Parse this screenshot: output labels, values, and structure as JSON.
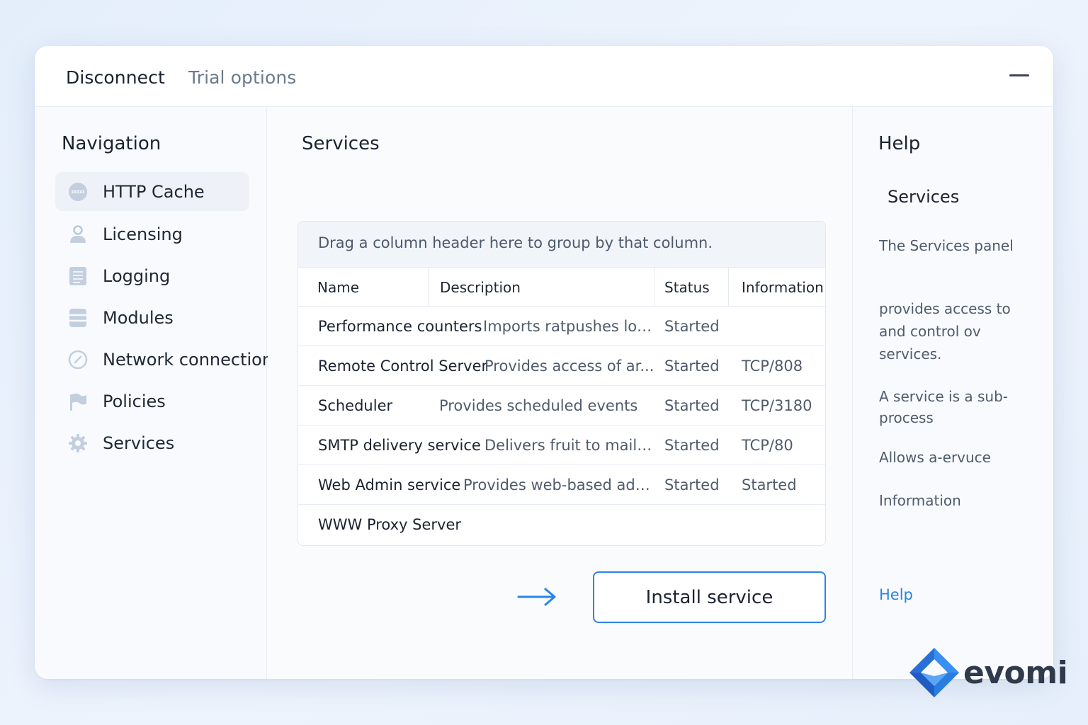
{
  "topbar": {
    "tabs": [
      {
        "label": "Disconnect",
        "active": true
      },
      {
        "label": "Trial options",
        "active": false
      }
    ]
  },
  "navigation": {
    "title": "Navigation",
    "items": [
      {
        "label": "HTTP Cache",
        "icon": "cache-icon",
        "selected": true
      },
      {
        "label": "Licensing",
        "icon": "user-icon",
        "selected": false
      },
      {
        "label": "Logging",
        "icon": "document-icon",
        "selected": false
      },
      {
        "label": "Modules",
        "icon": "modules-icon",
        "selected": false
      },
      {
        "label": "Network connection",
        "icon": "compass-icon",
        "selected": false
      },
      {
        "label": "Policies",
        "icon": "flag-icon",
        "selected": false
      },
      {
        "label": "Services",
        "icon": "gear-icon",
        "selected": false
      }
    ]
  },
  "main": {
    "title": "Services",
    "group_hint": "Drag a column header here to group by that column.",
    "columns": [
      "Name",
      "Description",
      "Status",
      "Information"
    ],
    "rows": [
      {
        "name": "Performance counters",
        "description": "Imports ratpushes loc...",
        "status": "Started",
        "info": ""
      },
      {
        "name": "Remote Control Server",
        "description": "Provides access of ar...",
        "status": "Started",
        "info": "TCP/808"
      },
      {
        "name": "Scheduler",
        "description": "Provides scheduled events",
        "status": "Started",
        "info": "TCP/3180"
      },
      {
        "name": "SMTP delivery service",
        "description": "Delivers fruit to mailb...",
        "status": "Started",
        "info": "TCP/80"
      },
      {
        "name": "Web Admin service",
        "description": "Provides web-based adm...",
        "status": "Started",
        "info": "Started"
      },
      {
        "name": "WWW Proxy Server",
        "description": "",
        "status": "",
        "info": ""
      }
    ],
    "install_button": "Install service"
  },
  "help": {
    "title": "Help",
    "subtitle": "Services",
    "paragraphs": [
      "The Services panel",
      "provides access to and control ov services.",
      "A service is a sub-process",
      "Allows a-ervuce",
      "Information"
    ],
    "link": "Help"
  },
  "brand": {
    "name": "evomi"
  },
  "colors": {
    "accent": "#2a84e8",
    "text": "#1c2330",
    "muted": "#4f5b6b",
    "icon": "#b9c7da"
  }
}
